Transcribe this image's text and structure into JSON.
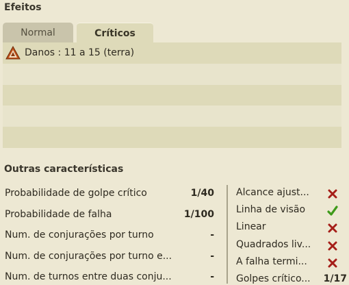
{
  "effects": {
    "title": "Efeitos",
    "tabs": [
      {
        "label": "Normal",
        "active": false
      },
      {
        "label": "Críticos",
        "active": true
      }
    ],
    "rows": [
      {
        "icon": "earth-damage-icon",
        "text": "Danos : 11 a 15 (terra)"
      },
      {
        "text": ""
      },
      {
        "text": ""
      },
      {
        "text": ""
      },
      {
        "text": ""
      }
    ]
  },
  "other": {
    "title": "Outras características",
    "left": [
      {
        "label": "Probabilidade de golpe crítico",
        "value": "1/40"
      },
      {
        "label": "Probabilidade de falha",
        "value": "1/100"
      },
      {
        "label": "Num. de conjurações por turno",
        "value": "-"
      },
      {
        "label": "Num. de conjurações por turno e...",
        "value": "-"
      },
      {
        "label": "Num. de turnos entre duas conju...",
        "value": "-"
      }
    ],
    "right": [
      {
        "label": "Alcance ajust...",
        "status": "no",
        "icon": "cross-icon"
      },
      {
        "label": "Linha de visão",
        "status": "yes",
        "icon": "check-icon"
      },
      {
        "label": "Linear",
        "status": "no",
        "icon": "cross-icon"
      },
      {
        "label": "Quadrados liv...",
        "status": "no",
        "icon": "cross-icon"
      },
      {
        "label": "A falha termi...",
        "status": "no",
        "icon": "cross-icon"
      },
      {
        "label": "Golpes crítico...",
        "value": "1/17"
      }
    ]
  },
  "colors": {
    "background": "#ede8d3",
    "row_dark": "#dedab9",
    "row_light": "#e8e4cc",
    "cross": "#a51e18",
    "check": "#3e9a1a",
    "earth": "#c0521a"
  }
}
